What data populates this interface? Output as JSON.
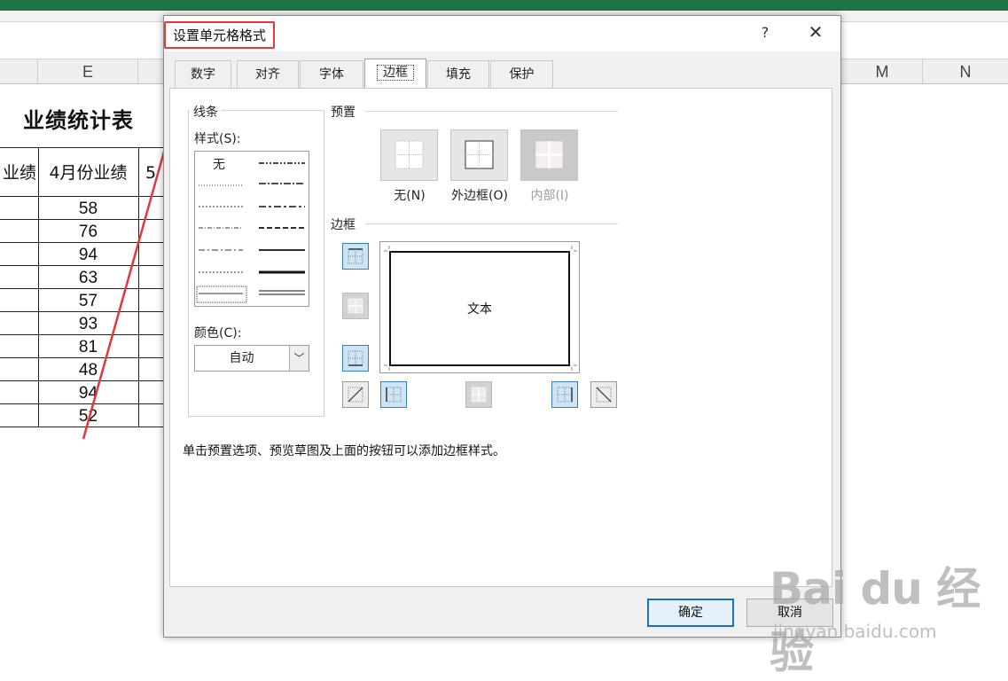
{
  "spreadsheet": {
    "column_headers": [
      "E",
      "M",
      "N"
    ],
    "sheet_title": "业绩统计表",
    "table_headers": [
      "业绩",
      "4月份业绩",
      "5"
    ],
    "april_values": [
      "58",
      "76",
      "94",
      "63",
      "57",
      "93",
      "81",
      "48",
      "94",
      "52"
    ]
  },
  "dialog": {
    "title": "设置单元格格式",
    "help_label": "?",
    "close_label": "✕",
    "tabs": [
      "数字",
      "对齐",
      "字体",
      "边框",
      "填充",
      "保护"
    ],
    "active_tab": "边框",
    "line_group": {
      "label": "线条",
      "style_label": "样式(S):",
      "style_none": "无",
      "color_label": "颜色(C):",
      "color_value": "自动",
      "dropdown_glyph": "﹀"
    },
    "presets": {
      "label": "预置",
      "none_label": "无(N)",
      "outline_label": "外边框(O)",
      "inside_label": "内部(I)"
    },
    "border": {
      "label": "边框",
      "preview_text": "文本"
    },
    "hint_text": "单击预置选项、预览草图及上面的按钮可以添加边框样式。",
    "ok_label": "确定",
    "cancel_label": "取消"
  },
  "watermark": {
    "logo_text": "Bai du 经验",
    "url_text": "jingyan.baidu.com"
  },
  "colors": {
    "excel_green": "#217346",
    "highlight_red": "#e0393d",
    "selected_blue": "#cde4f7"
  }
}
